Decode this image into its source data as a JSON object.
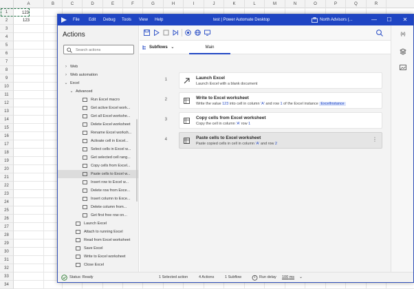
{
  "excel": {
    "columns": [
      "A",
      "B",
      "C",
      "D",
      "E",
      "F",
      "G",
      "H",
      "I",
      "J",
      "K",
      "L",
      "M",
      "N",
      "O",
      "P",
      "Q",
      "R"
    ],
    "rows": [
      "1",
      "2",
      "3",
      "4",
      "5",
      "6",
      "7",
      "8",
      "9",
      "10",
      "11",
      "12",
      "13",
      "14",
      "15",
      "16",
      "17",
      "18",
      "19",
      "20",
      "21",
      "22",
      "23",
      "24",
      "25",
      "26",
      "27",
      "28",
      "29",
      "30",
      "31",
      "32",
      "33",
      "34"
    ],
    "cells": {
      "A1": "123",
      "A2": "123"
    }
  },
  "window": {
    "menu": [
      "File",
      "Edit",
      "Debug",
      "Tools",
      "View",
      "Help"
    ],
    "title": "test | Power Automate Desktop",
    "account": "North Advisors (...",
    "controls": {
      "minimize": "—",
      "maximize": "☐",
      "close": "✕"
    }
  },
  "actions_panel": {
    "title": "Actions",
    "search_placeholder": "Search actions",
    "groups": [
      {
        "label": "Web",
        "chevron": "›"
      },
      {
        "label": "Web automation",
        "chevron": "›"
      },
      {
        "label": "Excel",
        "chevron": "⌄"
      },
      {
        "label": "Advanced",
        "chevron": "⌄"
      }
    ],
    "advanced_items": [
      "Run Excel macro",
      "Get active Excel work...",
      "Get all Excel workshe...",
      "Delete Excel worksheet",
      "Rename Excel worksh...",
      "Activate cell in Excel...",
      "Select cells in Excel w...",
      "Get selected cell rang...",
      "Copy cells from Excel...",
      "Paste cells to Excel w...",
      "Insert row to Excel w...",
      "Delete row from Exce...",
      "Insert column to Exce...",
      "Delete column from...",
      "Get first free row on..."
    ],
    "selected_index": 9,
    "excel_items": [
      "Launch Excel",
      "Attach to running Excel",
      "Read from Excel worksheet",
      "Save Excel",
      "Write to Excel worksheet",
      "Close Excel"
    ]
  },
  "toolbar": {
    "icons": [
      "save-icon",
      "run-icon",
      "stop-icon",
      "step-icon",
      "record-icon",
      "web-recorder-icon",
      "desktop-recorder-icon"
    ]
  },
  "right_rail": {
    "variables_label": "{x}"
  },
  "subflows": {
    "label": "Subflows",
    "chevron": "⌄",
    "main_tab": "Main"
  },
  "steps": [
    {
      "num": "1",
      "title": "Launch Excel",
      "desc": "Launch Excel with a blank document"
    },
    {
      "num": "2",
      "title": "Write to Excel worksheet",
      "desc_pre": "Write the value ",
      "value": "123",
      "desc_mid": " into cell in column ",
      "col": "'A'",
      "desc_mid2": " and row ",
      "row": "1",
      "desc_mid3": " of the Excel instance ",
      "instance": "ExcelInstance"
    },
    {
      "num": "3",
      "title": "Copy cells from Excel worksheet",
      "desc_pre": "Copy the cell in column ",
      "col": "'A'",
      "desc_mid": " row ",
      "row": "1"
    },
    {
      "num": "4",
      "title": "Paste cells to Excel worksheet",
      "desc_pre": "Paste copied cells in cell in column ",
      "col": "'A'",
      "desc_mid": " and row ",
      "row": "2",
      "more": "⋮"
    }
  ],
  "status": {
    "state": "Status: Ready",
    "selected": "1 Selected action",
    "actions": "4 Actions",
    "subflows": "1 Subflow",
    "run_delay_label": "Run delay",
    "run_delay_value": "100",
    "run_delay_unit": "ms"
  }
}
